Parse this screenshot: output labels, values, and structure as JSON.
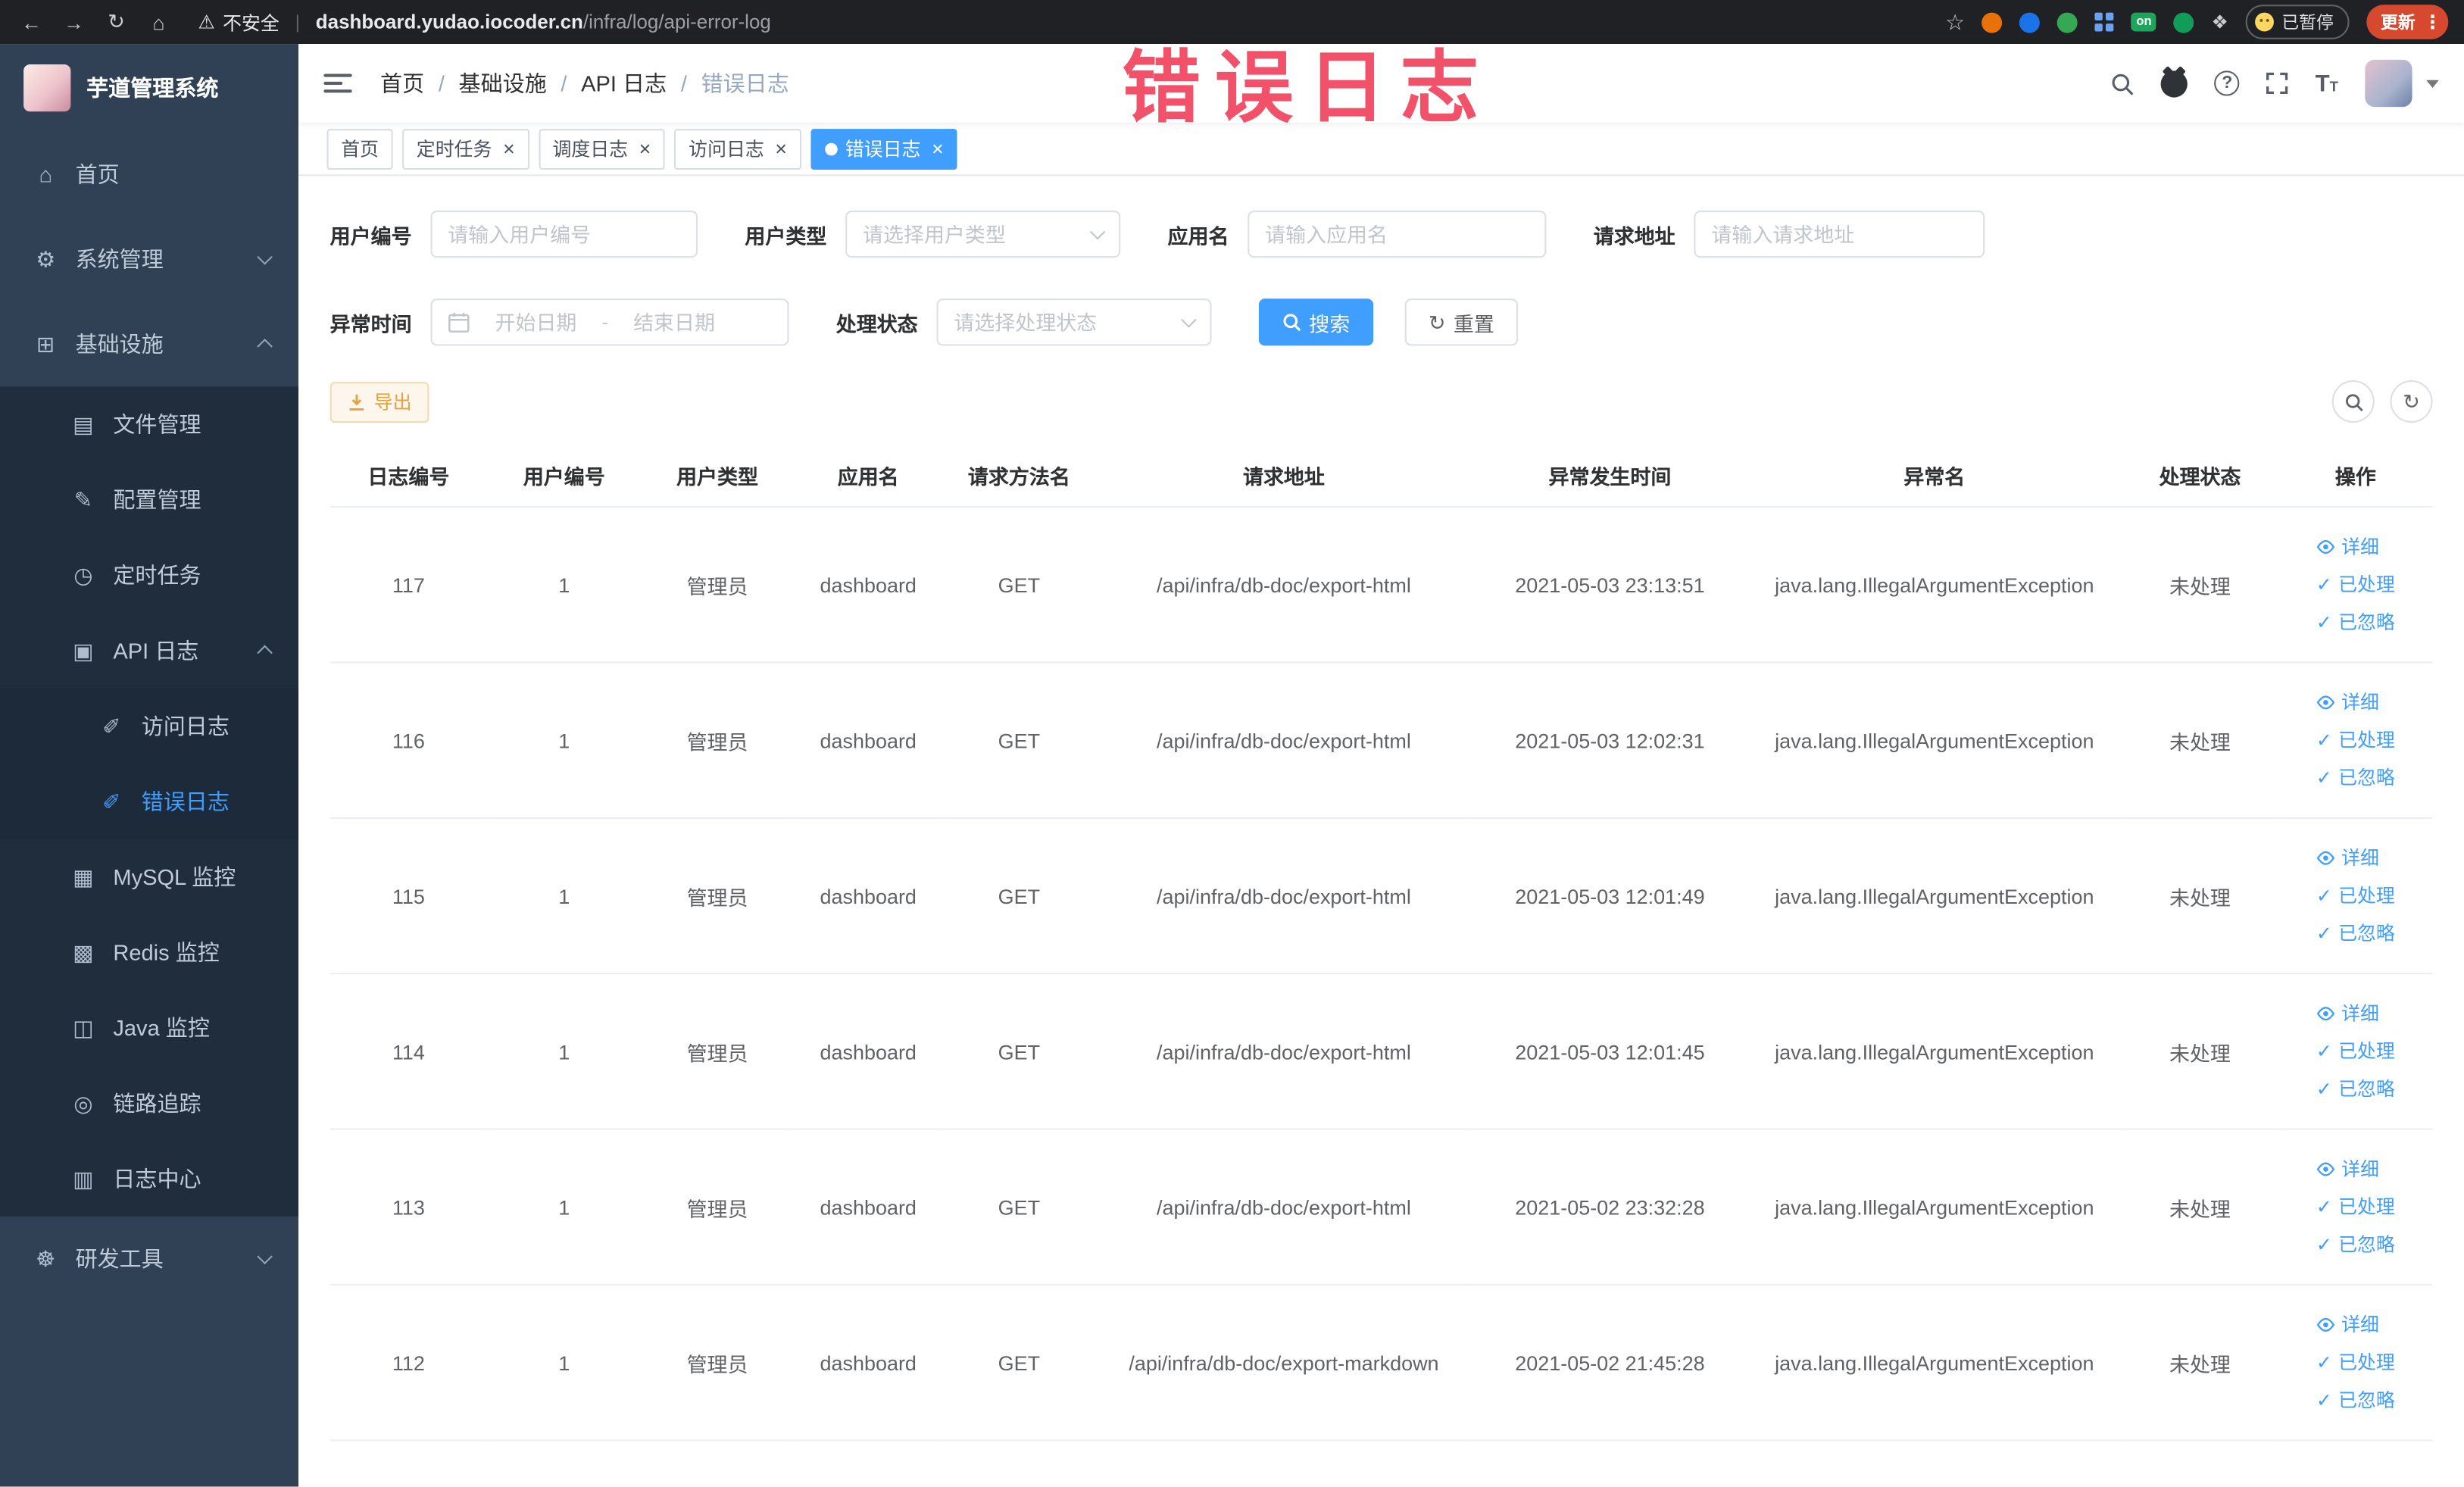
{
  "browser": {
    "security_text": "不安全",
    "url_domain": "dashboard.yudao.iocoder.cn",
    "url_path": "/infra/log/api-error-log",
    "extension_on_badge": "on",
    "paused_badge": "已暂停",
    "update_button": "更新"
  },
  "watermark": "错误日志",
  "sidebar": {
    "app_title": "芋道管理系统",
    "items": [
      {
        "label": "首页",
        "icon": "home-icon",
        "level": 1
      },
      {
        "label": "系统管理",
        "icon": "gear-icon",
        "level": 1,
        "chevron": "down"
      },
      {
        "label": "基础设施",
        "icon": "infrastructure-icon",
        "level": 1,
        "chevron": "up"
      },
      {
        "label": "文件管理",
        "icon": "file-icon",
        "level": 2
      },
      {
        "label": "配置管理",
        "icon": "config-icon",
        "level": 2
      },
      {
        "label": "定时任务",
        "icon": "timer-icon",
        "level": 2
      },
      {
        "label": "API 日志",
        "icon": "api-log-icon",
        "level": 2,
        "chevron": "up"
      },
      {
        "label": "访问日志",
        "icon": "access-log-icon",
        "level": 3
      },
      {
        "label": "错误日志",
        "icon": "error-log-icon",
        "level": 3,
        "active": true
      },
      {
        "label": "MySQL 监控",
        "icon": "mysql-icon",
        "level": 2
      },
      {
        "label": "Redis 监控",
        "icon": "redis-icon",
        "level": 2
      },
      {
        "label": "Java 监控",
        "icon": "java-icon",
        "level": 2
      },
      {
        "label": "链路追踪",
        "icon": "trace-icon",
        "level": 2
      },
      {
        "label": "日志中心",
        "icon": "log-center-icon",
        "level": 2
      },
      {
        "label": "研发工具",
        "icon": "tools-icon",
        "level": 1,
        "chevron": "down"
      }
    ]
  },
  "icon_glyphs": {
    "home-icon": "⌂",
    "gear-icon": "⚙",
    "infrastructure-icon": "⊞",
    "file-icon": "▤",
    "config-icon": "✎",
    "timer-icon": "◷",
    "api-log-icon": "▣",
    "access-log-icon": "✐",
    "error-log-icon": "✐",
    "mysql-icon": "▦",
    "redis-icon": "▩",
    "java-icon": "◫",
    "trace-icon": "◎",
    "log-center-icon": "▥",
    "tools-icon": "☸"
  },
  "header": {
    "breadcrumb": [
      "首页",
      "基础设施",
      "API 日志",
      "错误日志"
    ]
  },
  "tabs": [
    {
      "label": "首页",
      "closable": false,
      "active": false
    },
    {
      "label": "定时任务",
      "closable": true,
      "active": false
    },
    {
      "label": "调度日志",
      "closable": true,
      "active": false
    },
    {
      "label": "访问日志",
      "closable": true,
      "active": false
    },
    {
      "label": "错误日志",
      "closable": true,
      "active": true
    }
  ],
  "filters": {
    "user_id_label": "用户编号",
    "user_id_placeholder": "请输入用户编号",
    "user_type_label": "用户类型",
    "user_type_placeholder": "请选择用户类型",
    "app_name_label": "应用名",
    "app_name_placeholder": "请输入应用名",
    "request_url_label": "请求地址",
    "request_url_placeholder": "请输入请求地址",
    "exception_time_label": "异常时间",
    "start_date_placeholder": "开始日期",
    "end_date_placeholder": "结束日期",
    "range_separator": "-",
    "process_status_label": "处理状态",
    "process_status_placeholder": "请选择处理状态",
    "search_button": "搜索",
    "reset_button": "重置"
  },
  "toolbar": {
    "export_label": "导出"
  },
  "table": {
    "columns": [
      "日志编号",
      "用户编号",
      "用户类型",
      "应用名",
      "请求方法名",
      "请求地址",
      "异常发生时间",
      "异常名",
      "处理状态",
      "操作"
    ],
    "actions": [
      "详细",
      "已处理",
      "已忽略"
    ],
    "rows": [
      {
        "id": "117",
        "user_id": "1",
        "user_type": "管理员",
        "app": "dashboard",
        "method": "GET",
        "url": "/api/infra/db-doc/export-html",
        "time": "2021-05-03 23:13:51",
        "exception": "java.lang.IllegalArgumentException",
        "status": "未处理"
      },
      {
        "id": "116",
        "user_id": "1",
        "user_type": "管理员",
        "app": "dashboard",
        "method": "GET",
        "url": "/api/infra/db-doc/export-html",
        "time": "2021-05-03 12:02:31",
        "exception": "java.lang.IllegalArgumentException",
        "status": "未处理"
      },
      {
        "id": "115",
        "user_id": "1",
        "user_type": "管理员",
        "app": "dashboard",
        "method": "GET",
        "url": "/api/infra/db-doc/export-html",
        "time": "2021-05-03 12:01:49",
        "exception": "java.lang.IllegalArgumentException",
        "status": "未处理"
      },
      {
        "id": "114",
        "user_id": "1",
        "user_type": "管理员",
        "app": "dashboard",
        "method": "GET",
        "url": "/api/infra/db-doc/export-html",
        "time": "2021-05-03 12:01:45",
        "exception": "java.lang.IllegalArgumentException",
        "status": "未处理"
      },
      {
        "id": "113",
        "user_id": "1",
        "user_type": "管理员",
        "app": "dashboard",
        "method": "GET",
        "url": "/api/infra/db-doc/export-html",
        "time": "2021-05-02 23:32:28",
        "exception": "java.lang.IllegalArgumentException",
        "status": "未处理"
      },
      {
        "id": "112",
        "user_id": "1",
        "user_type": "管理员",
        "app": "dashboard",
        "method": "GET",
        "url": "/api/infra/db-doc/export-markdown",
        "time": "2021-05-02 21:45:28",
        "exception": "java.lang.IllegalArgumentException",
        "status": "未处理"
      }
    ]
  },
  "colors": {
    "accent_blue": "#409eff",
    "watermark_red": "#f2455e",
    "warning_orange": "#e6a23c",
    "sidebar_bg": "#304156",
    "submenu_bg": "#1f2d3d"
  }
}
